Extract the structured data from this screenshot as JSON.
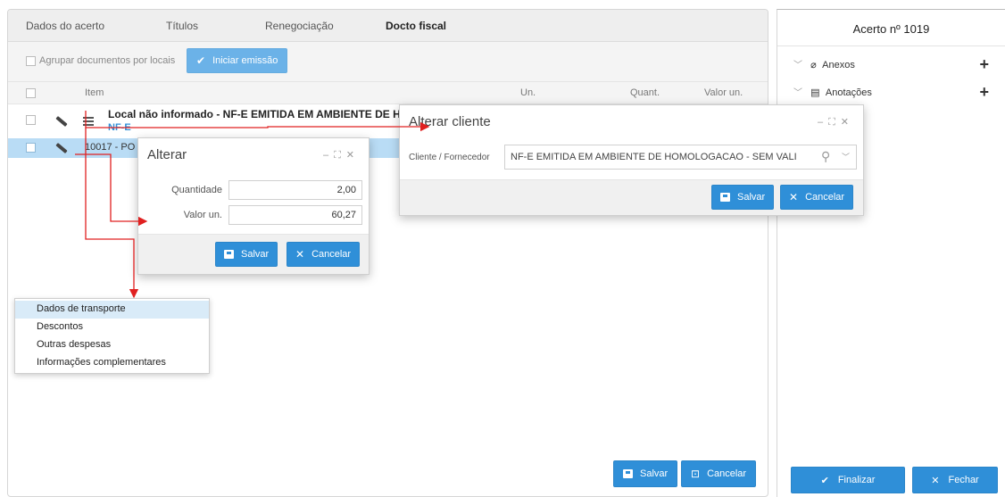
{
  "tabs": [
    "Dados do acerto",
    "Títulos",
    "Renegociação",
    "Docto fiscal"
  ],
  "toolbar": {
    "agrupar_label": "Agrupar documentos por locais",
    "iniciar_label": "Iniciar emissão"
  },
  "grid": {
    "col_item": "Item",
    "col_un": "Un.",
    "col_quant": "Quant.",
    "col_valor": "Valor un."
  },
  "rows": [
    {
      "title": "Local não informado - NF-E EMITIDA EM AMBIENTE DE HOI",
      "sub": "NF-E"
    },
    {
      "title": "10017 - PO"
    }
  ],
  "footer": {
    "salvar": "Salvar",
    "cancelar": "Cancelar"
  },
  "right": {
    "title": "Acerto nº 1019",
    "anexos": "Anexos",
    "anotacoes": "Anotações",
    "finalizar": "Finalizar",
    "fechar": "Fechar"
  },
  "alterar": {
    "title": "Alterar",
    "quantidade_label": "Quantidade",
    "quantidade_value": "2,00",
    "valor_label": "Valor un.",
    "valor_value": "60,27",
    "salvar": "Salvar",
    "cancelar": "Cancelar"
  },
  "cliente": {
    "title": "Alterar cliente",
    "label": "Cliente / Fornecedor",
    "value": "NF-E EMITIDA EM AMBIENTE DE HOMOLOGACAO - SEM VALI",
    "salvar": "Salvar",
    "cancelar": "Cancelar"
  },
  "menu": [
    "Dados de transporte",
    "Descontos",
    "Outras despesas",
    "Informações complementares"
  ],
  "colors": {
    "accent": "#2f8fd8",
    "arrow": "#e02020",
    "selected_row": "#b9dcf5"
  }
}
